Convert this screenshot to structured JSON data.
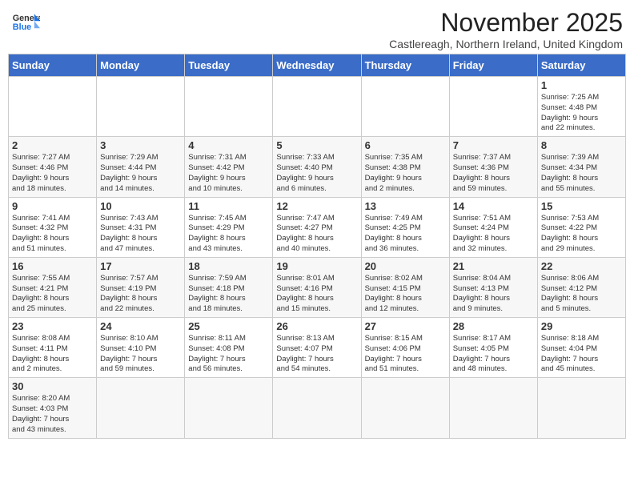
{
  "header": {
    "logo_line1": "General",
    "logo_line2": "Blue",
    "month_title": "November 2025",
    "subtitle": "Castlereagh, Northern Ireland, United Kingdom"
  },
  "weekdays": [
    "Sunday",
    "Monday",
    "Tuesday",
    "Wednesday",
    "Thursday",
    "Friday",
    "Saturday"
  ],
  "weeks": [
    [
      {
        "day": "",
        "info": ""
      },
      {
        "day": "",
        "info": ""
      },
      {
        "day": "",
        "info": ""
      },
      {
        "day": "",
        "info": ""
      },
      {
        "day": "",
        "info": ""
      },
      {
        "day": "",
        "info": ""
      },
      {
        "day": "1",
        "info": "Sunrise: 7:25 AM\nSunset: 4:48 PM\nDaylight: 9 hours\nand 22 minutes."
      }
    ],
    [
      {
        "day": "2",
        "info": "Sunrise: 7:27 AM\nSunset: 4:46 PM\nDaylight: 9 hours\nand 18 minutes."
      },
      {
        "day": "3",
        "info": "Sunrise: 7:29 AM\nSunset: 4:44 PM\nDaylight: 9 hours\nand 14 minutes."
      },
      {
        "day": "4",
        "info": "Sunrise: 7:31 AM\nSunset: 4:42 PM\nDaylight: 9 hours\nand 10 minutes."
      },
      {
        "day": "5",
        "info": "Sunrise: 7:33 AM\nSunset: 4:40 PM\nDaylight: 9 hours\nand 6 minutes."
      },
      {
        "day": "6",
        "info": "Sunrise: 7:35 AM\nSunset: 4:38 PM\nDaylight: 9 hours\nand 2 minutes."
      },
      {
        "day": "7",
        "info": "Sunrise: 7:37 AM\nSunset: 4:36 PM\nDaylight: 8 hours\nand 59 minutes."
      },
      {
        "day": "8",
        "info": "Sunrise: 7:39 AM\nSunset: 4:34 PM\nDaylight: 8 hours\nand 55 minutes."
      }
    ],
    [
      {
        "day": "9",
        "info": "Sunrise: 7:41 AM\nSunset: 4:32 PM\nDaylight: 8 hours\nand 51 minutes."
      },
      {
        "day": "10",
        "info": "Sunrise: 7:43 AM\nSunset: 4:31 PM\nDaylight: 8 hours\nand 47 minutes."
      },
      {
        "day": "11",
        "info": "Sunrise: 7:45 AM\nSunset: 4:29 PM\nDaylight: 8 hours\nand 43 minutes."
      },
      {
        "day": "12",
        "info": "Sunrise: 7:47 AM\nSunset: 4:27 PM\nDaylight: 8 hours\nand 40 minutes."
      },
      {
        "day": "13",
        "info": "Sunrise: 7:49 AM\nSunset: 4:25 PM\nDaylight: 8 hours\nand 36 minutes."
      },
      {
        "day": "14",
        "info": "Sunrise: 7:51 AM\nSunset: 4:24 PM\nDaylight: 8 hours\nand 32 minutes."
      },
      {
        "day": "15",
        "info": "Sunrise: 7:53 AM\nSunset: 4:22 PM\nDaylight: 8 hours\nand 29 minutes."
      }
    ],
    [
      {
        "day": "16",
        "info": "Sunrise: 7:55 AM\nSunset: 4:21 PM\nDaylight: 8 hours\nand 25 minutes."
      },
      {
        "day": "17",
        "info": "Sunrise: 7:57 AM\nSunset: 4:19 PM\nDaylight: 8 hours\nand 22 minutes."
      },
      {
        "day": "18",
        "info": "Sunrise: 7:59 AM\nSunset: 4:18 PM\nDaylight: 8 hours\nand 18 minutes."
      },
      {
        "day": "19",
        "info": "Sunrise: 8:01 AM\nSunset: 4:16 PM\nDaylight: 8 hours\nand 15 minutes."
      },
      {
        "day": "20",
        "info": "Sunrise: 8:02 AM\nSunset: 4:15 PM\nDaylight: 8 hours\nand 12 minutes."
      },
      {
        "day": "21",
        "info": "Sunrise: 8:04 AM\nSunset: 4:13 PM\nDaylight: 8 hours\nand 9 minutes."
      },
      {
        "day": "22",
        "info": "Sunrise: 8:06 AM\nSunset: 4:12 PM\nDaylight: 8 hours\nand 5 minutes."
      }
    ],
    [
      {
        "day": "23",
        "info": "Sunrise: 8:08 AM\nSunset: 4:11 PM\nDaylight: 8 hours\nand 2 minutes."
      },
      {
        "day": "24",
        "info": "Sunrise: 8:10 AM\nSunset: 4:10 PM\nDaylight: 7 hours\nand 59 minutes."
      },
      {
        "day": "25",
        "info": "Sunrise: 8:11 AM\nSunset: 4:08 PM\nDaylight: 7 hours\nand 56 minutes."
      },
      {
        "day": "26",
        "info": "Sunrise: 8:13 AM\nSunset: 4:07 PM\nDaylight: 7 hours\nand 54 minutes."
      },
      {
        "day": "27",
        "info": "Sunrise: 8:15 AM\nSunset: 4:06 PM\nDaylight: 7 hours\nand 51 minutes."
      },
      {
        "day": "28",
        "info": "Sunrise: 8:17 AM\nSunset: 4:05 PM\nDaylight: 7 hours\nand 48 minutes."
      },
      {
        "day": "29",
        "info": "Sunrise: 8:18 AM\nSunset: 4:04 PM\nDaylight: 7 hours\nand 45 minutes."
      }
    ],
    [
      {
        "day": "30",
        "info": "Sunrise: 8:20 AM\nSunset: 4:03 PM\nDaylight: 7 hours\nand 43 minutes."
      },
      {
        "day": "",
        "info": ""
      },
      {
        "day": "",
        "info": ""
      },
      {
        "day": "",
        "info": ""
      },
      {
        "day": "",
        "info": ""
      },
      {
        "day": "",
        "info": ""
      },
      {
        "day": "",
        "info": ""
      }
    ]
  ]
}
